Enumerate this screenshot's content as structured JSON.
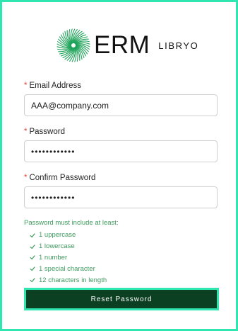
{
  "logo": {
    "brand": "ERM",
    "product": "LIBRYO"
  },
  "form": {
    "required_marker": "*",
    "email": {
      "label": "Email Address",
      "value": "AAA@company.com"
    },
    "password": {
      "label": "Password",
      "value": "••••••••••••"
    },
    "confirm_password": {
      "label": "Confirm Password",
      "value": "••••••••••••"
    }
  },
  "requirements": {
    "title": "Password must include at least:",
    "items": [
      "1 uppercase",
      "1 lowercase",
      "1 number",
      "1 special character",
      "12 characters in length"
    ]
  },
  "submit": {
    "label": "Reset Password"
  },
  "colors": {
    "accent": "#2fe6b0",
    "button": "#0b4023",
    "success": "#3e9a5e",
    "required": "#e24a3b"
  }
}
